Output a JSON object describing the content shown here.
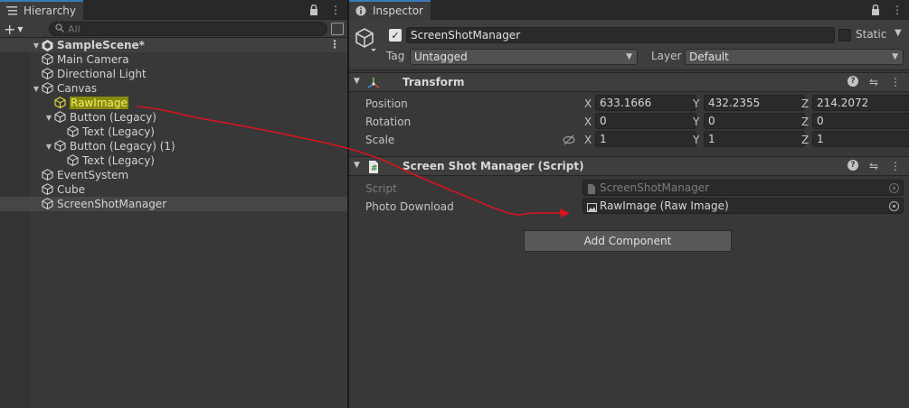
{
  "colors": {
    "panel_bg": "#383838",
    "selected_row": "#464646",
    "highlight_bg": "#8a8a10",
    "highlight_text": "#f0f060",
    "annotation_red": "#d8141c",
    "tab_accent": "#3a79bb"
  },
  "hierarchy": {
    "tab_label": "Hierarchy",
    "tab_icon": "list-icon",
    "search_placeholder": "All",
    "scene_name": "SampleScene*",
    "items": [
      {
        "label": "Main Camera",
        "depth": 1,
        "expanded": null,
        "icon": "cube-icon"
      },
      {
        "label": "Directional Light",
        "depth": 1,
        "expanded": null,
        "icon": "cube-icon"
      },
      {
        "label": "Canvas",
        "depth": 1,
        "expanded": true,
        "icon": "cube-icon"
      },
      {
        "label": "RawImage",
        "depth": 2,
        "expanded": null,
        "icon": "cube-icon",
        "highlighted": true
      },
      {
        "label": "Button (Legacy)",
        "depth": 2,
        "expanded": true,
        "icon": "cube-icon"
      },
      {
        "label": "Text (Legacy)",
        "depth": 3,
        "expanded": null,
        "icon": "cube-icon"
      },
      {
        "label": "Button (Legacy) (1)",
        "depth": 2,
        "expanded": true,
        "icon": "cube-icon"
      },
      {
        "label": "Text (Legacy)",
        "depth": 3,
        "expanded": null,
        "icon": "cube-icon"
      },
      {
        "label": "EventSystem",
        "depth": 1,
        "expanded": null,
        "icon": "cube-icon"
      },
      {
        "label": "Cube",
        "depth": 1,
        "expanded": null,
        "icon": "cube-icon"
      },
      {
        "label": "ScreenShotManager",
        "depth": 1,
        "expanded": null,
        "icon": "cube-icon",
        "selected": true
      }
    ]
  },
  "inspector": {
    "tab_label": "Inspector",
    "tab_icon": "info-icon",
    "object": {
      "name": "ScreenShotManager",
      "active": true,
      "static_label": "Static",
      "tag_label": "Tag",
      "tag_value": "Untagged",
      "layer_label": "Layer",
      "layer_value": "Default"
    },
    "transform": {
      "title": "Transform",
      "rows": [
        {
          "label": "Position",
          "x": "633.1666",
          "y": "432.2355",
          "z": "214.2072"
        },
        {
          "label": "Rotation",
          "x": "0",
          "y": "0",
          "z": "0"
        },
        {
          "label": "Scale",
          "x": "1",
          "y": "1",
          "z": "1"
        }
      ],
      "axis_x": "X",
      "axis_y": "Y",
      "axis_z": "Z"
    },
    "script_component": {
      "title": "Screen Shot Manager (Script)",
      "script_label": "Script",
      "script_value": "ScreenShotManager",
      "photo_label": "Photo Download",
      "photo_value": "RawImage (Raw Image)"
    },
    "add_component_label": "Add Component"
  }
}
